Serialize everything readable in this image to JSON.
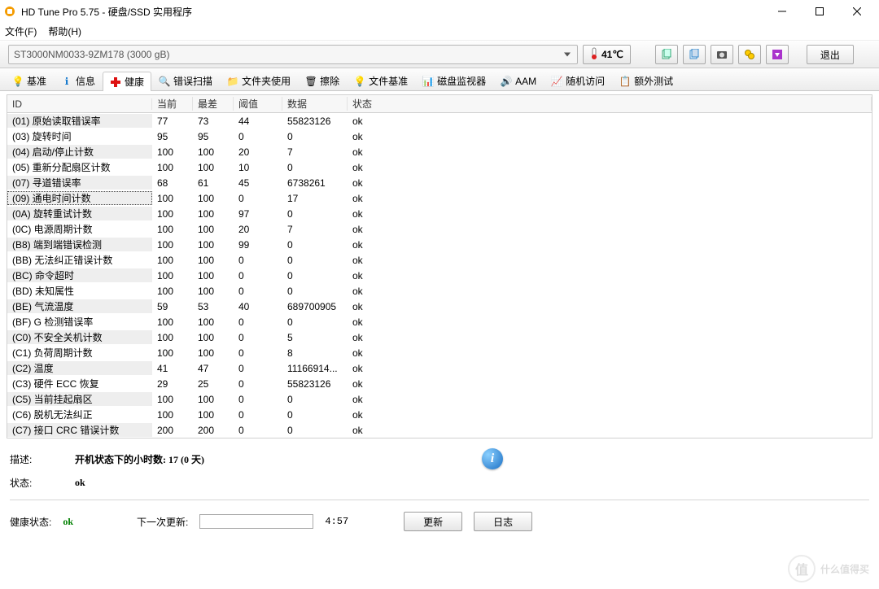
{
  "window": {
    "title": "HD Tune Pro 5.75 - 硬盘/SSD 实用程序"
  },
  "menu": {
    "file": "文件(F)",
    "help": "帮助(H)"
  },
  "toolbar": {
    "drive": "ST3000NM0033-9ZM178 (3000 gB)",
    "temp": "41℃",
    "exit": "退出"
  },
  "tabs": {
    "benchmark": "基准",
    "info": "信息",
    "health": "健康",
    "errorscan": "错误扫描",
    "folder": "文件夹使用",
    "erase": "擦除",
    "filebench": "文件基准",
    "diskmon": "磁盘监视器",
    "aam": "AAM",
    "random": "随机访问",
    "extra": "额外测试"
  },
  "headers": {
    "id": "ID",
    "current": "当前",
    "worst": "最差",
    "threshold": "阈值",
    "data": "数据",
    "status": "状态"
  },
  "rows": [
    {
      "id": "(01) 原始读取错误率",
      "cur": "77",
      "worst": "73",
      "thr": "44",
      "data": "55823126",
      "st": "ok",
      "shade": true
    },
    {
      "id": "(03) 旋转时间",
      "cur": "95",
      "worst": "95",
      "thr": "0",
      "data": "0",
      "st": "ok"
    },
    {
      "id": "(04) 启动/停止计数",
      "cur": "100",
      "worst": "100",
      "thr": "20",
      "data": "7",
      "st": "ok",
      "shade": true
    },
    {
      "id": "(05) 重新分配扇区计数",
      "cur": "100",
      "worst": "100",
      "thr": "10",
      "data": "0",
      "st": "ok"
    },
    {
      "id": "(07) 寻道错误率",
      "cur": "68",
      "worst": "61",
      "thr": "45",
      "data": "6738261",
      "st": "ok",
      "shade": true
    },
    {
      "id": "(09) 通电时间计数",
      "cur": "100",
      "worst": "100",
      "thr": "0",
      "data": "17",
      "st": "ok",
      "selected": true
    },
    {
      "id": "(0A) 旋转重试计数",
      "cur": "100",
      "worst": "100",
      "thr": "97",
      "data": "0",
      "st": "ok",
      "shade": true
    },
    {
      "id": "(0C) 电源周期计数",
      "cur": "100",
      "worst": "100",
      "thr": "20",
      "data": "7",
      "st": "ok"
    },
    {
      "id": "(B8) 端到端错误检测",
      "cur": "100",
      "worst": "100",
      "thr": "99",
      "data": "0",
      "st": "ok",
      "shade": true
    },
    {
      "id": "(BB) 无法纠正错误计数",
      "cur": "100",
      "worst": "100",
      "thr": "0",
      "data": "0",
      "st": "ok"
    },
    {
      "id": "(BC) 命令超时",
      "cur": "100",
      "worst": "100",
      "thr": "0",
      "data": "0",
      "st": "ok",
      "shade": true
    },
    {
      "id": "(BD) 未知属性",
      "cur": "100",
      "worst": "100",
      "thr": "0",
      "data": "0",
      "st": "ok"
    },
    {
      "id": "(BE) 气流温度",
      "cur": "59",
      "worst": "53",
      "thr": "40",
      "data": "689700905",
      "st": "ok",
      "shade": true
    },
    {
      "id": "(BF) G 检测错误率",
      "cur": "100",
      "worst": "100",
      "thr": "0",
      "data": "0",
      "st": "ok"
    },
    {
      "id": "(C0) 不安全关机计数",
      "cur": "100",
      "worst": "100",
      "thr": "0",
      "data": "5",
      "st": "ok",
      "shade": true
    },
    {
      "id": "(C1) 负荷周期计数",
      "cur": "100",
      "worst": "100",
      "thr": "0",
      "data": "8",
      "st": "ok"
    },
    {
      "id": "(C2) 温度",
      "cur": "41",
      "worst": "47",
      "thr": "0",
      "data": "11166914...",
      "st": "ok",
      "shade": true
    },
    {
      "id": "(C3) 硬件 ECC 恢复",
      "cur": "29",
      "worst": "25",
      "thr": "0",
      "data": "55823126",
      "st": "ok"
    },
    {
      "id": "(C5) 当前挂起扇区",
      "cur": "100",
      "worst": "100",
      "thr": "0",
      "data": "0",
      "st": "ok",
      "shade": true
    },
    {
      "id": "(C6) 脱机无法纠正",
      "cur": "100",
      "worst": "100",
      "thr": "0",
      "data": "0",
      "st": "ok"
    },
    {
      "id": "(C7) 接口 CRC 错误计数",
      "cur": "200",
      "worst": "200",
      "thr": "0",
      "data": "0",
      "st": "ok",
      "shade": true
    }
  ],
  "footer": {
    "desc_label": "描述:",
    "desc_value": "开机状态下的小时数: 17 (0 天)",
    "status_label": "状态:",
    "status_value": "ok",
    "health_label": "健康状态:",
    "health_value": "ok",
    "next_update_label": "下一次更新:",
    "next_update_time": "4:57",
    "refresh": "更新",
    "log": "日志"
  },
  "watermark": "什么值得买"
}
